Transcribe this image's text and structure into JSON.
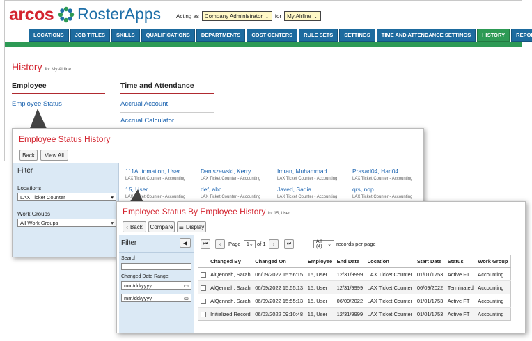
{
  "header": {
    "brand_arcos": "arcos",
    "brand_roster": "RosterApps",
    "acting_as": "Acting as",
    "role": "Company Administrator",
    "for": "for",
    "company": "My Airline"
  },
  "nav": [
    "LOCATIONS",
    "JOB TITLES",
    "SKILLS",
    "QUALIFICATIONS",
    "DEPARTMENTS",
    "COST CENTERS",
    "RULE SETS",
    "SETTINGS",
    "TIME AND ATTENDANCE SETTINGS",
    "HISTORY",
    "REPORTS"
  ],
  "nav_active": "HISTORY",
  "page": {
    "title": "History",
    "subtitle": "for My Airline",
    "col1": "Employee",
    "col1_links": [
      "Employee Status"
    ],
    "col2": "Time and Attendance",
    "col2_links": [
      "Accrual Account",
      "Accrual Calculator"
    ]
  },
  "panel2": {
    "title": "Employee Status History",
    "back": "Back",
    "view_all": "View All",
    "filter": {
      "title": "Filter",
      "locations_label": "Locations",
      "locations_value": "LAX Ticket Counter",
      "workgroups_label": "Work Groups",
      "workgroups_value": "All Work Groups"
    },
    "employees": [
      {
        "name": "111Automation, User",
        "sub": "LAX Ticket Counter - Accounting"
      },
      {
        "name": "Daniszewski, Kerry",
        "sub": "LAX Ticket Counter - Accounting"
      },
      {
        "name": "Imran, Muhammad",
        "sub": "LAX Ticket Counter - Accounting"
      },
      {
        "name": "Prasad04, Hari04",
        "sub": "LAX Ticket Counter - Accounting"
      },
      {
        "name": "15, User",
        "sub": "LAX Ticket Counter - Accounting"
      },
      {
        "name": "def, abc",
        "sub": "LAX Ticket Counter - Accounting"
      },
      {
        "name": "Javed, Sadia",
        "sub": "LAX Ticket Counter - Accounting"
      },
      {
        "name": "qrs, nop",
        "sub": "LAX Ticket Counter - Accounting"
      }
    ]
  },
  "panel3": {
    "title": "Employee Status By Employee History",
    "subtitle": "for 15, User",
    "back": "Back",
    "compare": "Compare",
    "display": "Display",
    "filter": {
      "title": "Filter",
      "search_label": "Search",
      "search_value": "",
      "date_label": "Changed Date Range",
      "date_from": "mm/dd/yyyy",
      "date_to": "mm/dd/yyyy"
    },
    "pager": {
      "page_label": "Page",
      "page": "1",
      "of": "of 1",
      "per_page": "All (4)",
      "per_page_label": "records per page"
    },
    "columns": [
      "Changed By",
      "Changed On",
      "Employee",
      "End Date",
      "Location",
      "Start Date",
      "Status",
      "Work Group"
    ],
    "rows": [
      [
        "AlQennah, Sarah",
        "06/09/2022 15:56:15",
        "15, User",
        "12/31/9999",
        "LAX Ticket Counter",
        "01/01/1753",
        "Active FT",
        "Accounting"
      ],
      [
        "AlQennah, Sarah",
        "06/09/2022 15:55:13",
        "15, User",
        "12/31/9999",
        "LAX Ticket Counter",
        "06/09/2022",
        "Terminated",
        "Accounting"
      ],
      [
        "AlQennah, Sarah",
        "06/09/2022 15:55:13",
        "15, User",
        "06/09/2022",
        "LAX Ticket Counter",
        "01/01/1753",
        "Active FT",
        "Accounting"
      ],
      [
        "Initialized Record",
        "06/03/2022 09:10:48",
        "15, User",
        "12/31/9999",
        "LAX Ticket Counter",
        "01/01/1753",
        "Active FT",
        "Accounting"
      ]
    ]
  },
  "colors": {
    "brand_red": "#d3232e",
    "nav_blue": "#1d6b9f",
    "nav_active": "#2d9a55",
    "link": "#1c64b0",
    "filter_bg": "#dbe9f5"
  }
}
